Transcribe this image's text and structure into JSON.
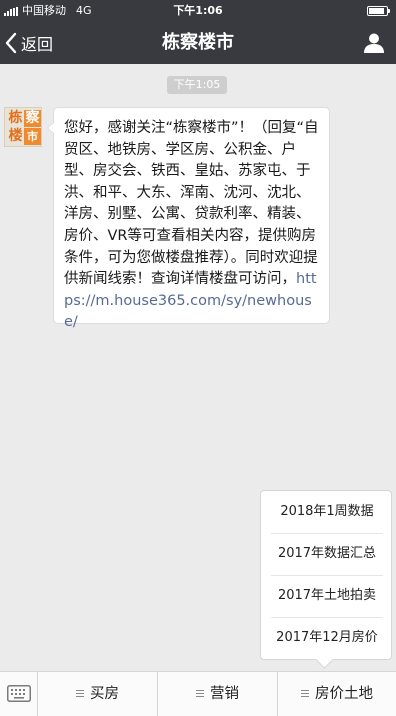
{
  "status_bar": {
    "carrier": "中国移动",
    "network": "4G",
    "time": "下午1:06",
    "battery_level": 0.9
  },
  "nav": {
    "back_label": "返回",
    "title": "栋察楼市",
    "back_icon": "chevron-left-icon",
    "profile_icon": "person-icon"
  },
  "chat": {
    "timestamp": "下午1:05",
    "avatar_chars": [
      "栋",
      "察",
      "楼",
      "市"
    ],
    "message_text": "您好，感谢关注“栋察楼市”！（回复“自贸区、地铁房、学区房、公积金、户型、房交会、铁西、皇姑、苏家屯、于洪、和平、大东、浑南、沈河、沈北、洋房、别墅、公寓、贷款利率、精装、房价、VR等可查看相关内容，提供购房条件，可为您做楼盘推荐）。同时欢迎提供新闻线索！查询详情楼盘可访问，",
    "message_link": "https://m.house365.com/sy/newhouse/"
  },
  "submenu": {
    "items": [
      "2018年1周数据",
      "2017年数据汇总",
      "2017年土地拍卖",
      "2017年12月房价"
    ]
  },
  "bottom_menu": {
    "keyboard_icon": "keyboard-icon",
    "tabs": [
      "买房",
      "营销",
      "房价土地"
    ]
  },
  "colors": {
    "header_bg": "#393a3f",
    "chat_bg": "#ebebeb",
    "link": "#576b95",
    "brand_orange": "#ef8a2e"
  }
}
